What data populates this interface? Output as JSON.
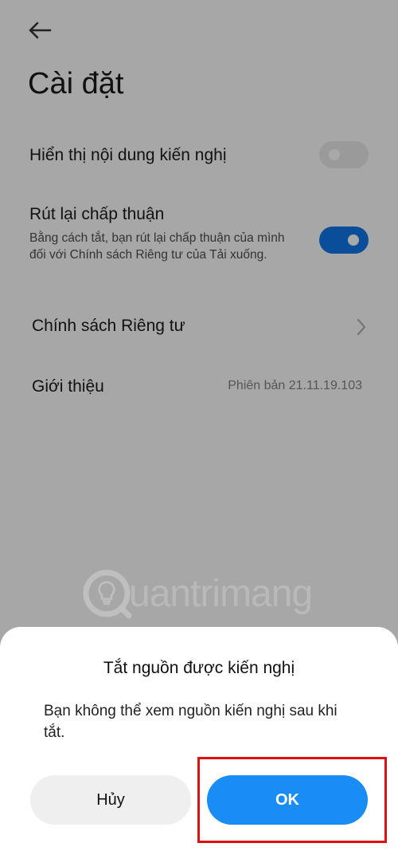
{
  "header": {
    "back_icon": "arrow-left-icon",
    "title": "Cài đặt"
  },
  "settings": {
    "recommendations": {
      "label": "Hiển thị nội dung kiến nghị",
      "enabled": false
    },
    "withdraw_consent": {
      "label": "Rút lại chấp thuận",
      "description": "Bằng cách tắt, bạn rút lại chấp thuận của mình đối với Chính sách Riêng tư của Tải xuống.",
      "enabled": true
    },
    "privacy_policy": {
      "label": "Chính sách Riêng tư",
      "icon": "chevron-right-icon"
    },
    "about": {
      "label": "Giới thiệu",
      "version": "Phiên bản 21.11.19.103"
    }
  },
  "watermark": {
    "text": "uantrimang"
  },
  "dialog": {
    "title": "Tắt nguồn được kiến nghị",
    "message": "Bạn không thể xem nguồn kiến nghị sau khi tắt.",
    "cancel_label": "Hủy",
    "ok_label": "OK"
  },
  "colors": {
    "accent": "#1a8cf5",
    "toggle_on": "#0a4e9a",
    "highlight": "#e01010",
    "scrim": "#a7a7a7"
  }
}
